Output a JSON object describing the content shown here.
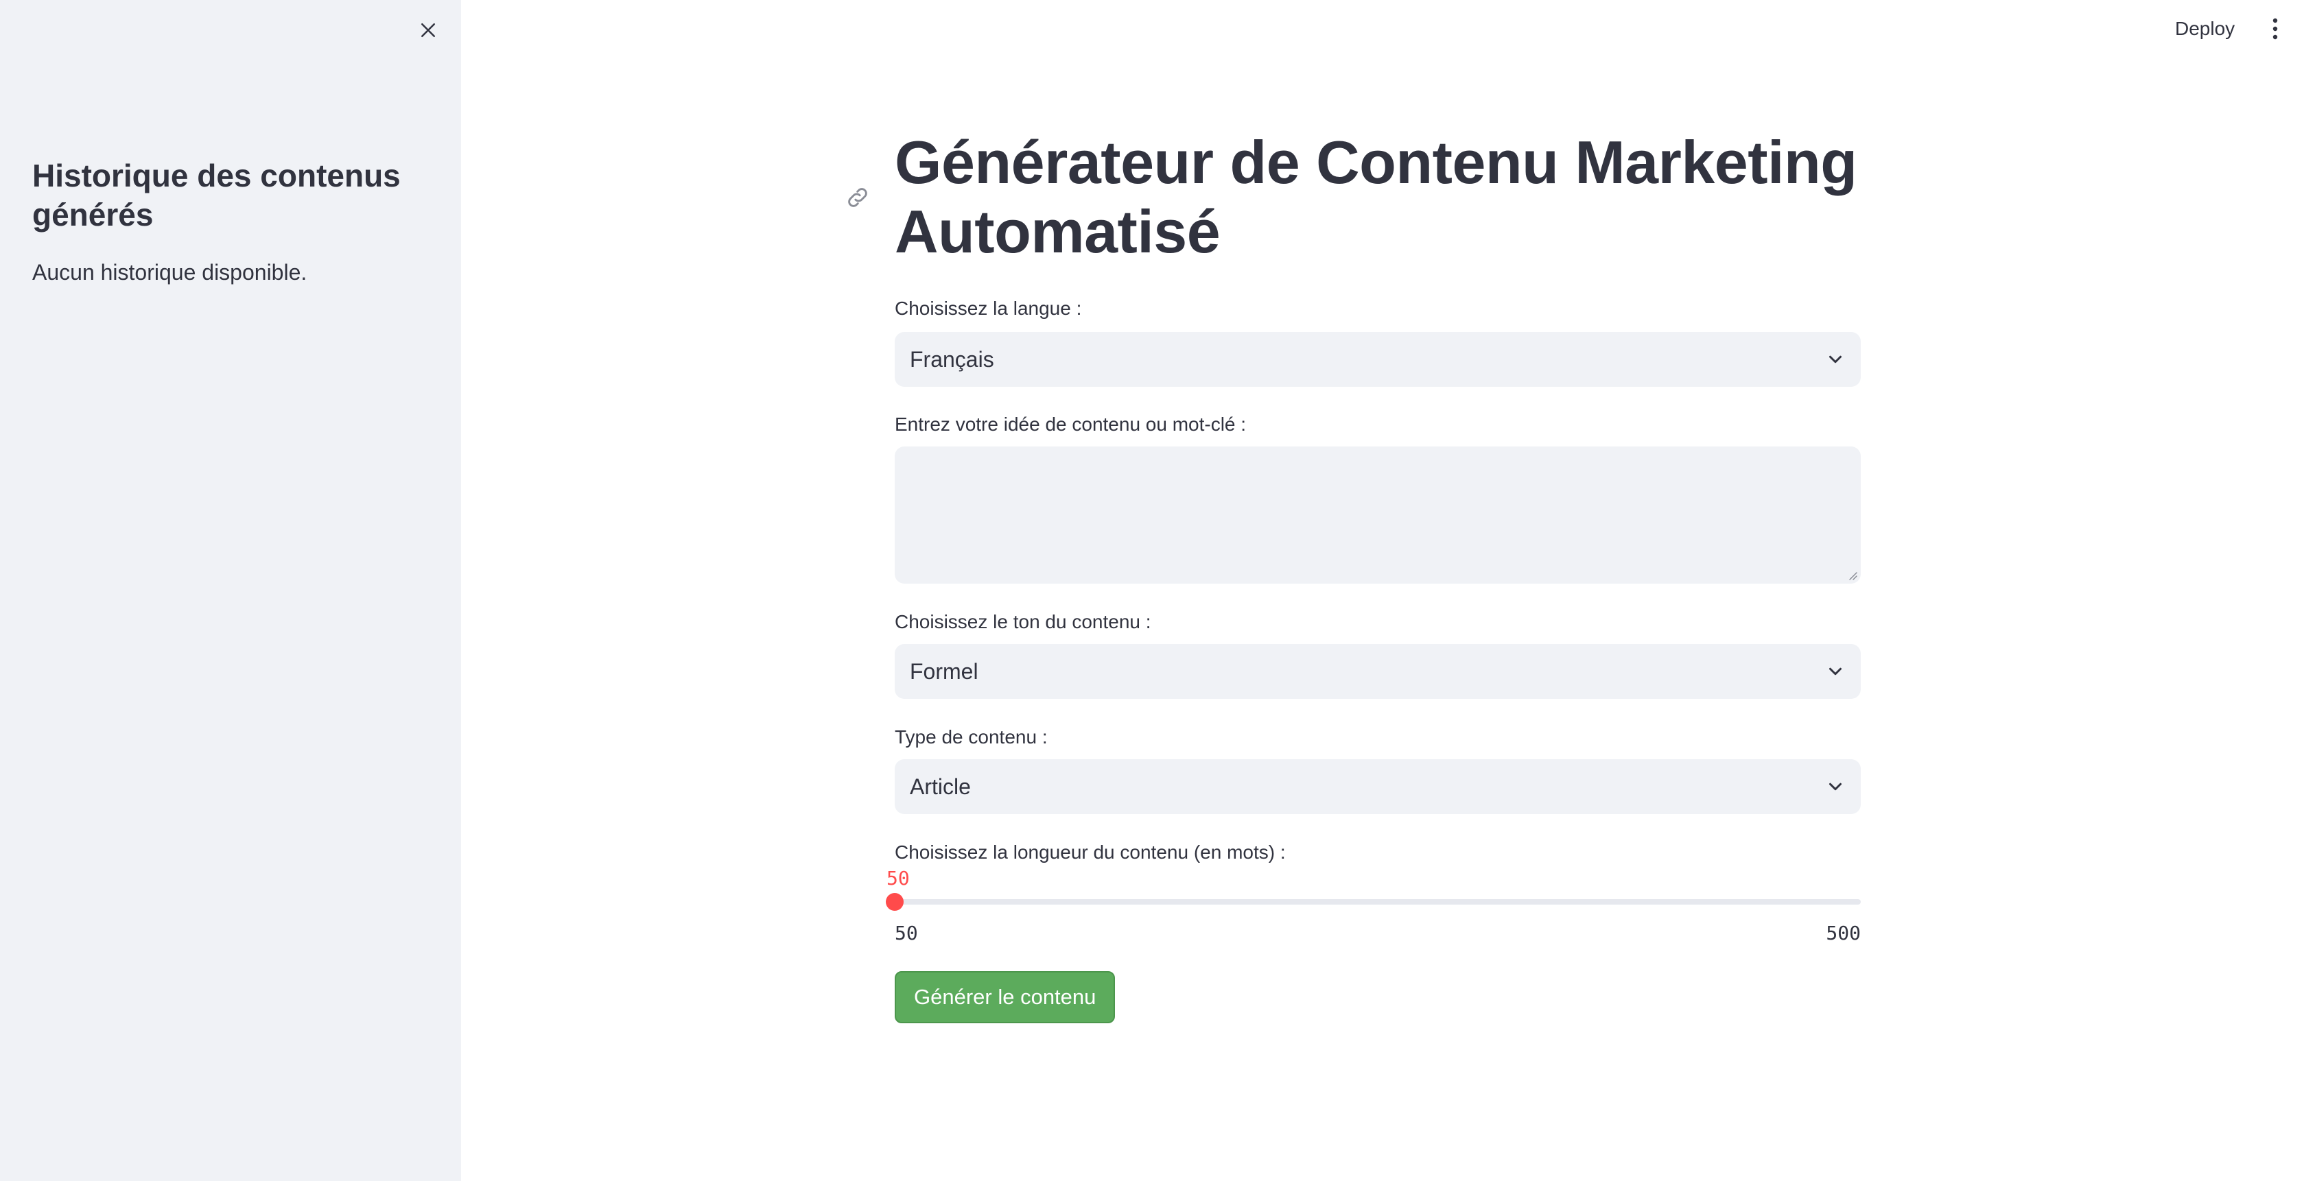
{
  "sidebar": {
    "title": "Historique des contenus générés",
    "empty_message": "Aucun historique disponible."
  },
  "header": {
    "deploy_label": "Deploy"
  },
  "main": {
    "title": "Générateur de Contenu Marketing Automatisé",
    "language": {
      "label": "Choisissez la langue :",
      "selected": "Français"
    },
    "idea": {
      "label": "Entrez votre idée de contenu ou mot-clé :",
      "value": ""
    },
    "tone": {
      "label": "Choisissez le ton du contenu :",
      "selected": "Formel"
    },
    "content_type": {
      "label": "Type de contenu :",
      "selected": "Article"
    },
    "length": {
      "label": "Choisissez la longueur du contenu (en mots) :",
      "value": 50,
      "min": 50,
      "max": 500,
      "value_label": "50",
      "min_label": "50",
      "max_label": "500"
    },
    "generate_label": "Générer le contenu"
  },
  "colors": {
    "sidebar_bg": "#f0f2f6",
    "input_bg": "#f0f2f6",
    "slider_accent": "#ff4b4b",
    "button_bg": "#5cab5c",
    "text": "#31333f"
  },
  "icons": {
    "sidebar_close": "close-icon",
    "menu": "vertical-dots-icon",
    "anchor": "link-icon",
    "select": "chevron-down-icon"
  }
}
